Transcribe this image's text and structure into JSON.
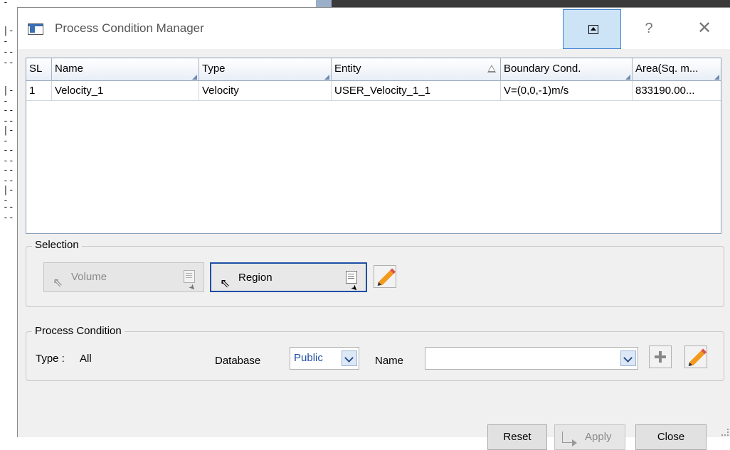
{
  "background": {
    "tree_marks": [
      "-",
      "|--",
      "----",
      "|--",
      "----",
      "|--",
      "----",
      "----",
      "|--",
      "----"
    ]
  },
  "window": {
    "title": "Process Condition Manager",
    "help_glyph": "?",
    "close_glyph": "✕"
  },
  "table": {
    "columns": [
      "SL",
      "Name",
      "Type",
      "Entity",
      "Boundary Cond.",
      "Area(Sq. m..."
    ],
    "rows": [
      [
        "1",
        "Velocity_1",
        "Velocity",
        "USER_Velocity_1_1",
        "V=(0,0,-1)m/s",
        "833190.00..."
      ]
    ]
  },
  "selection": {
    "group_label": "Selection",
    "volume_label": "Volume",
    "region_label": "Region",
    "arrow_glyph": "⇖"
  },
  "process_condition": {
    "group_label": "Process Condition",
    "type_label": "Type :",
    "type_value": "All",
    "database_label": "Database",
    "database_value": "Public",
    "name_label": "Name",
    "name_value": ""
  },
  "footer": {
    "reset_label": "Reset",
    "apply_label": "Apply",
    "close_label": "Close"
  },
  "colors": {
    "accent": "#1f4fa5",
    "pin_highlight": "#cde4f7",
    "dialog_bg": "#f0f0f0"
  }
}
